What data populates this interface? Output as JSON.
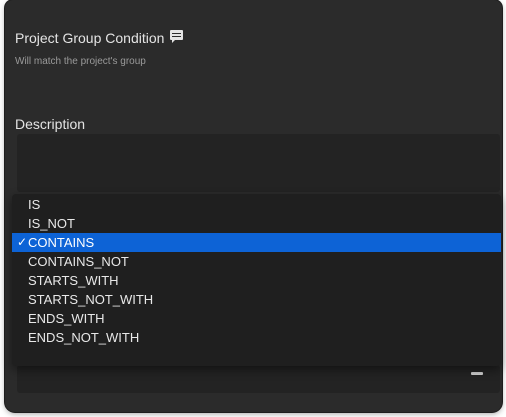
{
  "condition": {
    "title": "Project Group Condition",
    "subtitle": "Will match the project's group",
    "title_icon": "comment-icon"
  },
  "description": {
    "label": "Description",
    "value": ""
  },
  "operator_menu": {
    "selected": "CONTAINS",
    "checkmark": "✓",
    "options": [
      "IS",
      "IS_NOT",
      "CONTAINS",
      "CONTAINS_NOT",
      "STARTS_WITH",
      "STARTS_NOT_WITH",
      "ENDS_WITH",
      "ENDS_NOT_WITH"
    ]
  },
  "colors": {
    "window_bg": "#2b2b2b",
    "field_bg": "#232323",
    "menu_bg": "#1f1f1f",
    "selection": "#0d63d6",
    "text": "#e4e4e4",
    "muted_text": "#9a9a9a"
  }
}
